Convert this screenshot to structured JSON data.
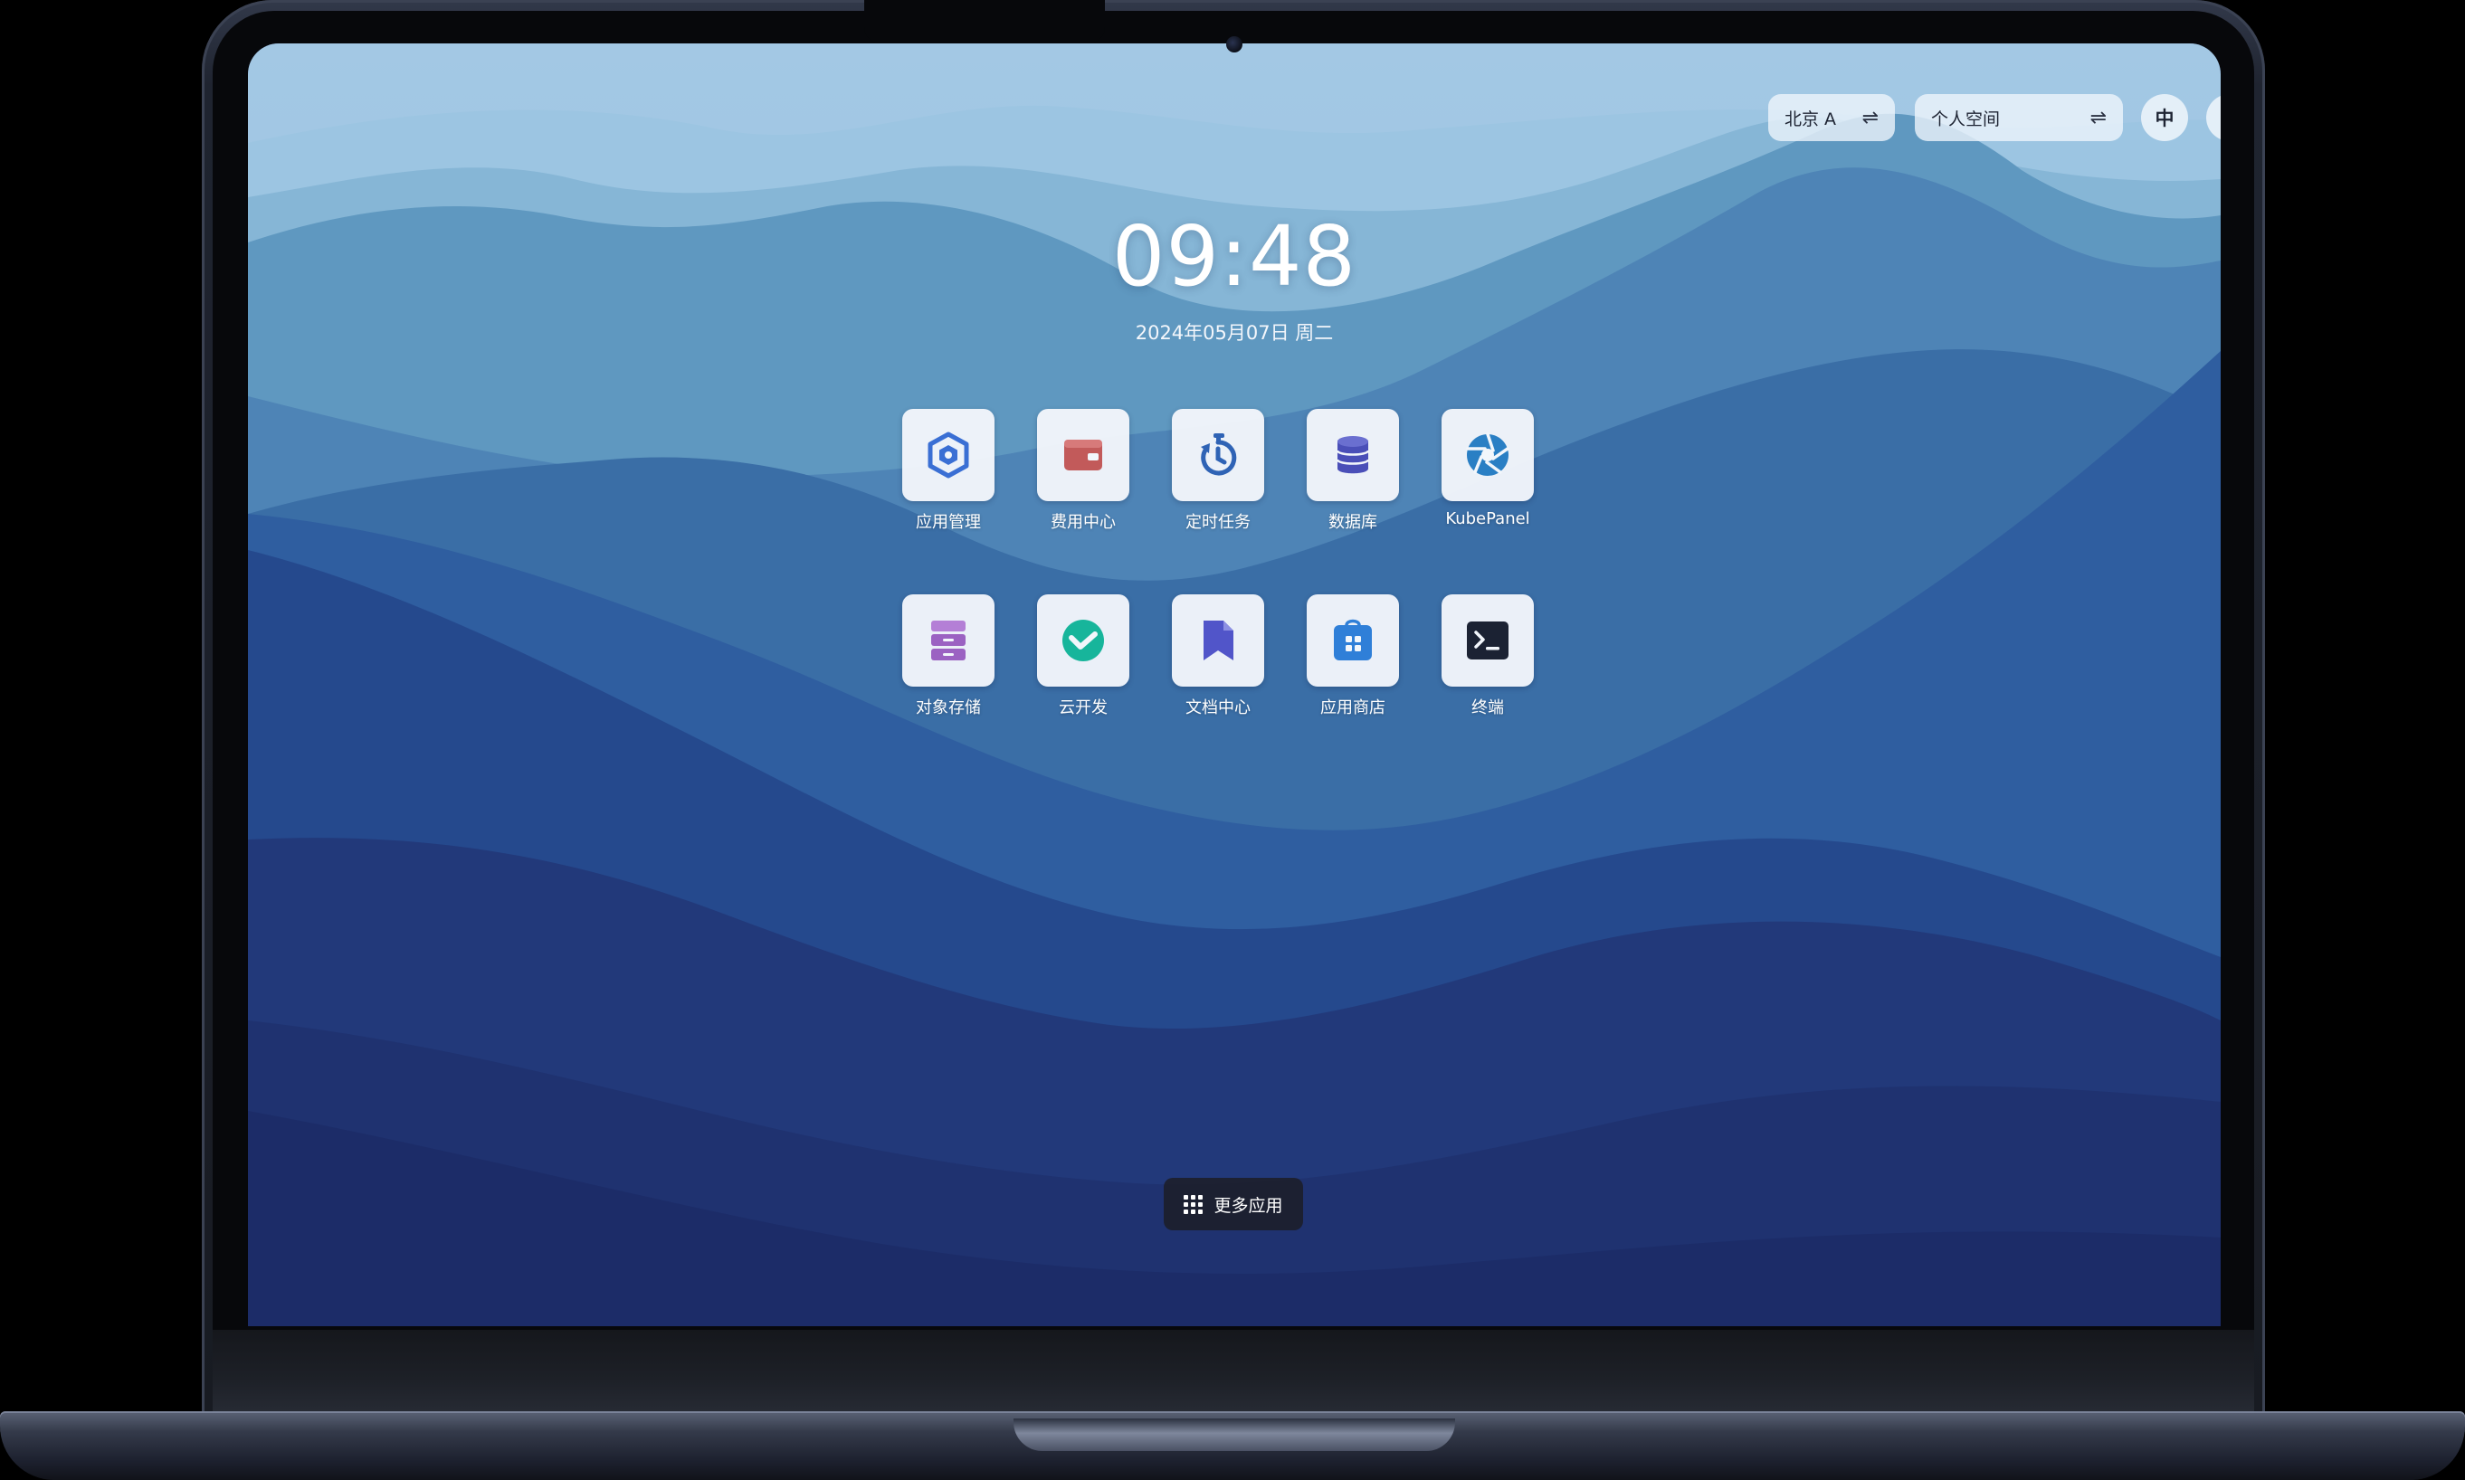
{
  "topbar": {
    "region": {
      "label": "北京 A",
      "icon": "swap-icon"
    },
    "workspace": {
      "label": "个人空间",
      "icon": "swap-icon"
    },
    "language": {
      "label": "中"
    }
  },
  "clock": {
    "time": "09:48",
    "date": "2024年05月07日 周二"
  },
  "apps": [
    {
      "label": "应用管理",
      "icon": "app-manage-icon",
      "color": "#3a6fd4"
    },
    {
      "label": "费用中心",
      "icon": "wallet-icon",
      "color": "#c25a5a"
    },
    {
      "label": "定时任务",
      "icon": "stopwatch-icon",
      "color": "#2f63b5"
    },
    {
      "label": "数据库",
      "icon": "database-icon",
      "color": "#4a4fb8"
    },
    {
      "label": "KubePanel",
      "icon": "aperture-icon",
      "color": "#2a7fc4"
    },
    {
      "label": "对象存储",
      "icon": "storage-cabinet-icon",
      "color": "#9b62c2"
    },
    {
      "label": "云开发",
      "icon": "cloud-dev-icon",
      "color": "#17b59b"
    },
    {
      "label": "文档中心",
      "icon": "document-icon",
      "color": "#5155c9"
    },
    {
      "label": "应用商店",
      "icon": "app-store-icon",
      "color": "#2f7fd8"
    },
    {
      "label": "终端",
      "icon": "terminal-icon",
      "color": "#1b2233"
    }
  ],
  "more_apps": {
    "label": "更多应用",
    "icon": "grid-icon"
  }
}
